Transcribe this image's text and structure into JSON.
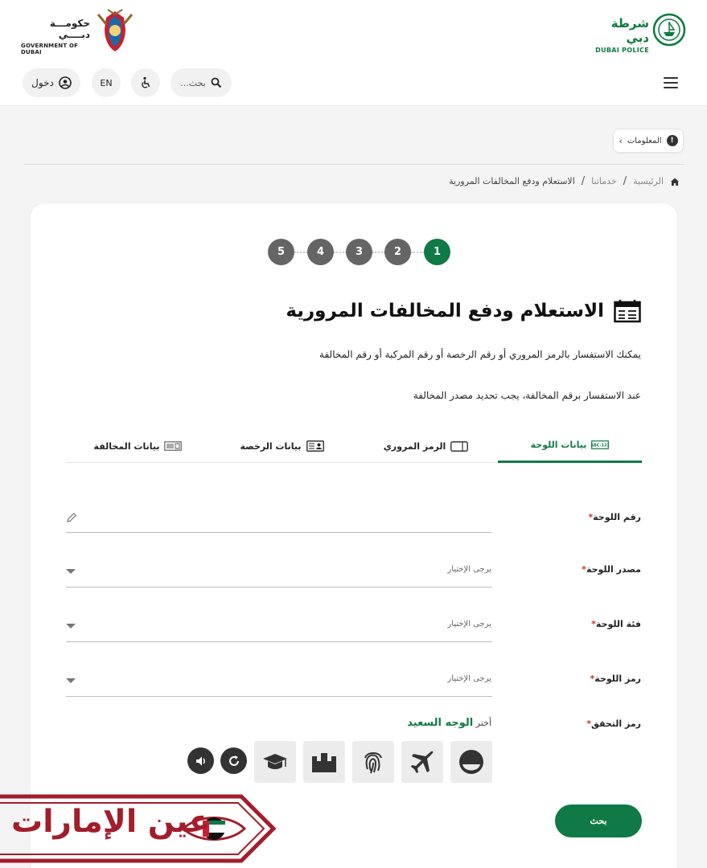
{
  "header": {
    "gov_name_ar": "حكومـــة دبــــي",
    "gov_name_en": "GOVERNMENT OF DUBAI",
    "police_name_ar": "شرطة دبي",
    "police_name_en": "DUBAI POLICE",
    "login_label": "دخول",
    "lang_label": "EN",
    "search_placeholder": "بحث..."
  },
  "info_button": {
    "label": "المعلومات"
  },
  "breadcrumb": {
    "home": "الرئيسية",
    "services": "خدماتنا",
    "current": "الاستعلام ودفع المخالفات المرورية"
  },
  "steps": [
    "1",
    "2",
    "3",
    "4",
    "5"
  ],
  "page": {
    "title": "الاستعلام ودفع المخالفات المرورية",
    "desc1": "يمكنك الاستفسار بالرمز المروري أو رقم الرخصة أو رقم المركبة أو رقم المخالفة",
    "desc2": "عند الاستفسار برقم المخالفة، يجب تحديد مصدر المخالفة"
  },
  "tabs": {
    "plate": "بيانات اللوحة",
    "traffic_code": "الرمز المروري",
    "license": "بيانات الرخصة",
    "fine": "بيانات المخالفة"
  },
  "form": {
    "plate_number_label": "رقم اللوحة",
    "plate_source_label": "مصدر اللوحة",
    "plate_category_label": "فئة اللوحة",
    "plate_code_label": "رمز اللوحة",
    "captcha_label": "رمز التحقق",
    "required_mark": "*",
    "select_placeholder": "يرجى الإختيار",
    "captcha_hint": "أختر",
    "captcha_target": "الوجه السعيد",
    "search_button": "بحث"
  },
  "captcha_icons": [
    "smiley-face-icon",
    "airplane-icon",
    "fingerprint-icon",
    "building-icon",
    "graduation-cap-icon"
  ],
  "watermark": {
    "text": "عين الإمارات"
  },
  "colors": {
    "brand_green": "#0f7a45",
    "step_gray": "#656565",
    "watermark_red": "#a31d2a"
  }
}
